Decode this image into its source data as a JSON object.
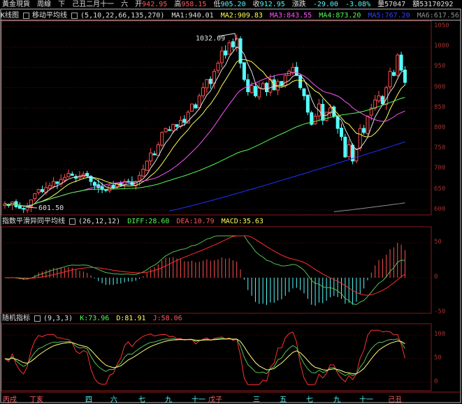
{
  "header": {
    "name": "黃金現貨",
    "period": "周線",
    "dir": "下",
    "date": "己丑二月十一",
    "weekday": "六",
    "open_label": "开",
    "open": "942.95",
    "high_label": "高",
    "high": "958.15",
    "low_label": "低",
    "low": "905.20",
    "close_label": "收",
    "close": "912.95",
    "change_label": "漲跌",
    "change": "-29.00",
    "change_pct": "-3.08%",
    "vol_label": "量",
    "vol": "57047",
    "amt_label": "額",
    "amt": "53170292"
  },
  "ma": {
    "panel": "K线图",
    "name": "移动平均线",
    "params": "(5,10,22,66,135,270)",
    "ma1": "MA1:940.01",
    "ma2": "MA2:909.83",
    "ma3": "MA3:843.55",
    "ma4": "MA4:873.20",
    "ma5": "MA5:767.20",
    "ma6": "MA6:617.56"
  },
  "macd": {
    "name": "指数平滑异同平均线",
    "params": "(26,12,12)",
    "diff": "DIFF:28.60",
    "dea": "DEA:10.79",
    "macd": "MACD:35.63"
  },
  "kdj": {
    "name": "随机指标",
    "params": "(9,3,3)",
    "k": "K:73.96",
    "d": "D:81.91",
    "j": "J:58.06"
  },
  "annotations": {
    "high": "1032.09",
    "low": "601.50"
  },
  "price_axis": [
    "1050",
    "1000",
    "950",
    "900",
    "850",
    "800",
    "750",
    "700",
    "650",
    "600"
  ],
  "macd_axis": [
    "50",
    "0",
    "-50"
  ],
  "kdj_axis": [
    "100",
    "50",
    "0"
  ],
  "date_axis": [
    "丙戌",
    "丁亥",
    "四",
    "六",
    "七",
    "九",
    "十一",
    "戊子",
    "三",
    "五",
    "七",
    "九",
    "十一",
    "己丑"
  ],
  "colors": {
    "up": "#ff5050",
    "down": "#54fcfc",
    "ma1": "#e0e0e0",
    "ma2": "#ffff54",
    "ma3": "#ff54ff",
    "ma4": "#54fc54",
    "ma5": "#2030ff",
    "ma6": "#909090"
  },
  "chart_data": {
    "type": "candlestick",
    "ylim": [
      590,
      1055
    ],
    "close": [
      615,
      612,
      620,
      608,
      604,
      602,
      610,
      625,
      640,
      650,
      645,
      655,
      660,
      670,
      665,
      675,
      680,
      690,
      685,
      678,
      682,
      688,
      684,
      670,
      660,
      655,
      650,
      648,
      660,
      655,
      665,
      660,
      670,
      668,
      662,
      670,
      685,
      700,
      720,
      740,
      735,
      760,
      790,
      800,
      795,
      810,
      805,
      820,
      815,
      840,
      860,
      850,
      880,
      900,
      920,
      910,
      940,
      960,
      990,
      980,
      1010,
      1000,
      1020,
      960,
      920,
      890,
      905,
      880,
      900,
      910,
      890,
      920,
      895,
      915,
      905,
      930,
      940,
      950,
      930,
      900,
      880,
      840,
      810,
      830,
      860,
      820,
      840,
      850,
      830,
      800,
      780,
      730,
      760,
      720,
      750,
      800,
      790,
      830,
      850,
      870,
      880,
      860,
      900,
      940,
      930,
      980,
      942.95,
      912.95
    ],
    "ma5_line": {
      "start_index": 44,
      "start": 598,
      "end": 767.2
    },
    "ma6_line": {
      "start_index": 88,
      "start": 596,
      "end": 617.56
    }
  }
}
